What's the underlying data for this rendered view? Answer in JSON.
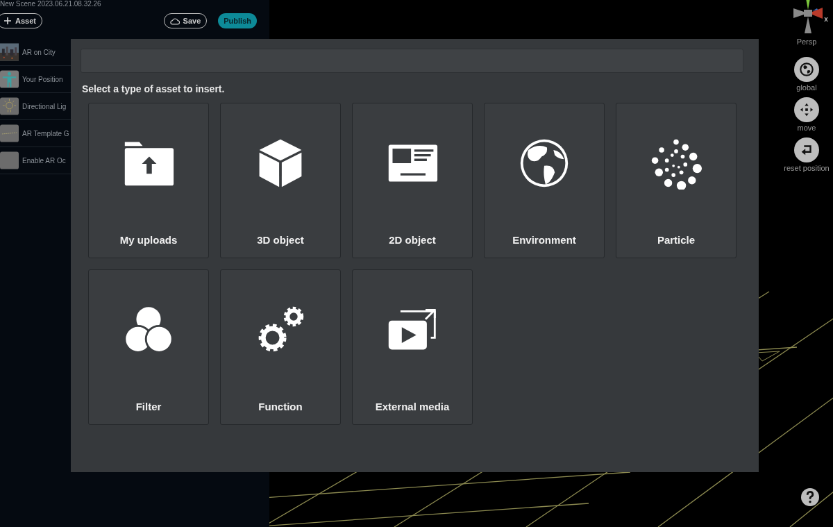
{
  "header": {
    "scene_title": "New Scene 2023.06.21.08.32.26"
  },
  "toolbar": {
    "add_button": "Asset",
    "save_button": "Save",
    "publish_button": "Publish"
  },
  "sidebar": {
    "items": [
      {
        "label": "AR on City"
      },
      {
        "label": "Your Position",
        "kind": "person"
      },
      {
        "label": "Directional Lig",
        "kind": "light"
      },
      {
        "label": "AR Template G",
        "kind": "template"
      },
      {
        "label": "Enable AR Oc",
        "kind": "blank"
      }
    ]
  },
  "viewport_tools": {
    "view_label": "Persp",
    "axis_label": "x",
    "tools": [
      {
        "label": "global",
        "kind": "globe"
      },
      {
        "label": "move",
        "kind": "move"
      },
      {
        "label": "reset position",
        "kind": "reset"
      }
    ]
  },
  "modal": {
    "prompt": "Select a type of asset to insert.",
    "assets": [
      {
        "label": "My uploads",
        "kind": "upload"
      },
      {
        "label": "3D object",
        "kind": "cube"
      },
      {
        "label": "2D object",
        "kind": "card"
      },
      {
        "label": "Environment",
        "kind": "globe"
      },
      {
        "label": "Particle",
        "kind": "particle"
      },
      {
        "label": "Filter",
        "kind": "filter"
      },
      {
        "label": "Function",
        "kind": "gears"
      },
      {
        "label": "External media",
        "kind": "media"
      }
    ]
  }
}
